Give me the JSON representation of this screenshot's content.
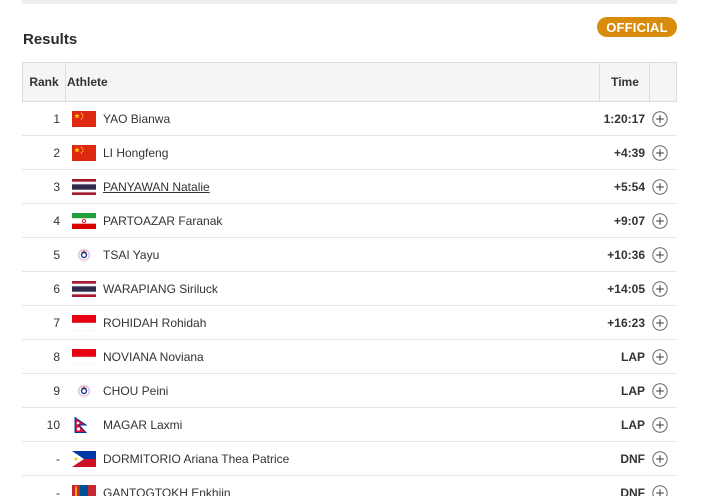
{
  "status_badge": "OFFICIAL",
  "heading": "Results",
  "columns": {
    "rank": "Rank",
    "athlete": "Athlete",
    "time": "Time"
  },
  "rows": [
    {
      "rank": "1",
      "flag": "china-flag",
      "athlete": "YAO Bianwa",
      "time": "1:20:17",
      "linked": false
    },
    {
      "rank": "2",
      "flag": "china-flag",
      "athlete": "LI Hongfeng",
      "time": "+4:39",
      "linked": false
    },
    {
      "rank": "3",
      "flag": "thailand-flag",
      "athlete": "PANYAWAN Natalie",
      "time": "+5:54",
      "linked": true
    },
    {
      "rank": "4",
      "flag": "iran-flag",
      "athlete": "PARTOAZAR Faranak",
      "time": "+9:07",
      "linked": false
    },
    {
      "rank": "5",
      "flag": "chinese-taipei-flag",
      "athlete": "TSAI Yayu",
      "time": "+10:36",
      "linked": false
    },
    {
      "rank": "6",
      "flag": "thailand-flag",
      "athlete": "WARAPIANG Siriluck",
      "time": "+14:05",
      "linked": false
    },
    {
      "rank": "7",
      "flag": "indonesia-flag",
      "athlete": "ROHIDAH Rohidah",
      "time": "+16:23",
      "linked": false
    },
    {
      "rank": "8",
      "flag": "indonesia-flag",
      "athlete": "NOVIANA Noviana",
      "time": "LAP",
      "linked": false
    },
    {
      "rank": "9",
      "flag": "chinese-taipei-flag",
      "athlete": "CHOU Peini",
      "time": "LAP",
      "linked": false
    },
    {
      "rank": "10",
      "flag": "nepal-flag",
      "athlete": "MAGAR Laxmi",
      "time": "LAP",
      "linked": false
    },
    {
      "rank": "-",
      "flag": "philippines-flag",
      "athlete": "DORMITORIO Ariana Thea Patrice",
      "time": "DNF",
      "linked": false
    },
    {
      "rank": "-",
      "flag": "mongolia-flag",
      "athlete": "GANTOGTOKH Enkhjin",
      "time": "DNF",
      "linked": false
    }
  ],
  "colors": {
    "badge": "#d98b0b",
    "header_bg": "#f5f5f5",
    "border": "#dcdcdc"
  }
}
